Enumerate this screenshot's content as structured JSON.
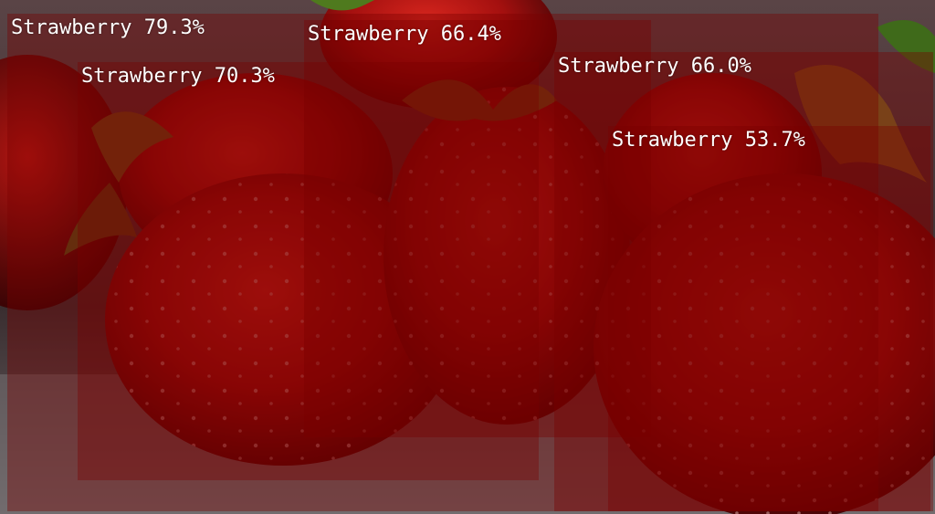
{
  "detections": [
    {
      "label": "Strawberry",
      "score": "79.3%"
    },
    {
      "label": "Strawberry",
      "score": "66.4%"
    },
    {
      "label": "Strawberry",
      "score": "70.3%"
    },
    {
      "label": "Strawberry",
      "score": "66.0%"
    },
    {
      "label": "Strawberry",
      "score": "53.7%"
    }
  ],
  "colors": {
    "box_fill": "#780000",
    "label_text": "#ffffff"
  }
}
